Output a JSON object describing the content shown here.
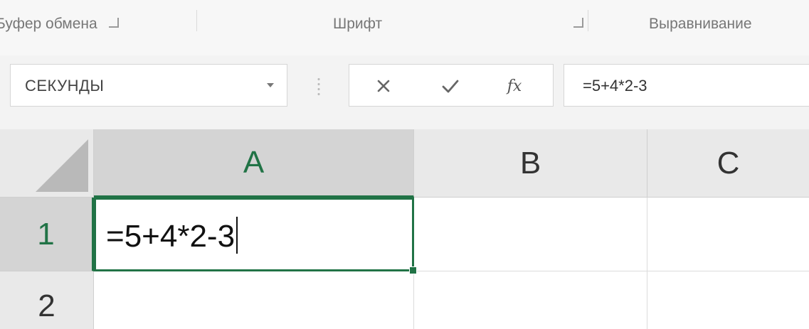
{
  "ribbon": {
    "groups": [
      {
        "label": "Буфер обмена"
      },
      {
        "label": "Шрифт"
      },
      {
        "label": "Выравнивание"
      }
    ]
  },
  "formula_bar": {
    "name_box": "СЕКУНДЫ",
    "cancel_glyph": "✕",
    "enter_glyph": "✓",
    "fx_label": "fx",
    "formula": "=5+4*2-3"
  },
  "sheet": {
    "columns": [
      "A",
      "B",
      "C"
    ],
    "rows": [
      "1",
      "2"
    ],
    "active_cell": "A1",
    "active_cell_content": "=5+4*2-3",
    "accent_color": "#217346"
  }
}
